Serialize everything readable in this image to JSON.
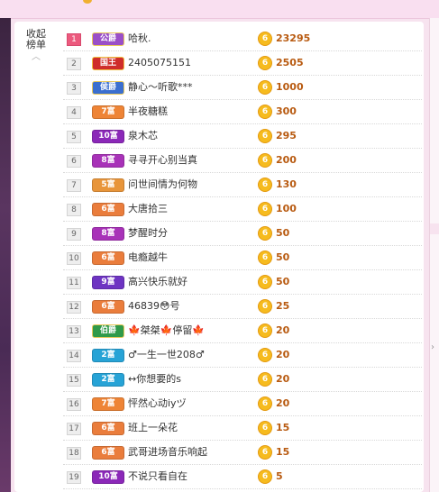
{
  "collapse_label_line1": "收起",
  "collapse_label_line2": "榜单",
  "collapse_arrow": "︿",
  "coin_glyph": "6",
  "rows": [
    {
      "rank": "1",
      "badge": "公爵",
      "badge_type": "gong",
      "name": "哈秋.",
      "amount": "23295"
    },
    {
      "rank": "2",
      "badge": "国王",
      "badge_type": "king",
      "name": "2405075151",
      "amount": "2505"
    },
    {
      "rank": "3",
      "badge": "侯爵",
      "badge_type": "hou",
      "name": "静心～听歌***",
      "amount": "1000"
    },
    {
      "rank": "4",
      "badge": "7富",
      "badge_type": "wealth7",
      "name": "半夜糖糕",
      "amount": "300"
    },
    {
      "rank": "5",
      "badge": "10富",
      "badge_type": "wealth10",
      "name": "泉木芯",
      "amount": "295"
    },
    {
      "rank": "6",
      "badge": "8富",
      "badge_type": "wealth8",
      "name": "寻寻开心别当真",
      "amount": "200"
    },
    {
      "rank": "7",
      "badge": "5富",
      "badge_type": "wealth5",
      "name": "问世间情为何物",
      "amount": "130"
    },
    {
      "rank": "8",
      "badge": "6富",
      "badge_type": "wealth6",
      "name": "大唐拾三",
      "amount": "100"
    },
    {
      "rank": "9",
      "badge": "8富",
      "badge_type": "wealth8",
      "name": "梦醒时分",
      "amount": "50"
    },
    {
      "rank": "10",
      "badge": "6富",
      "badge_type": "wealth6",
      "name": "电瘾越牛",
      "amount": "50"
    },
    {
      "rank": "11",
      "badge": "9富",
      "badge_type": "wealth9",
      "name": "高兴快乐就好",
      "amount": "50"
    },
    {
      "rank": "12",
      "badge": "6富",
      "badge_type": "wealth6",
      "name": "46839😳号",
      "amount": "25"
    },
    {
      "rank": "13",
      "badge": "伯爵",
      "badge_type": "bo",
      "name": "🍁桀桀🍁停留🍁",
      "amount": "20"
    },
    {
      "rank": "14",
      "badge": "2富",
      "badge_type": "wealth2",
      "name": "♂一生一世208♂",
      "amount": "20"
    },
    {
      "rank": "15",
      "badge": "2富",
      "badge_type": "wealth2",
      "name": "↔你想要的s",
      "amount": "20"
    },
    {
      "rank": "16",
      "badge": "7富",
      "badge_type": "wealth7",
      "name": "怦然心动iyヅ",
      "amount": "20"
    },
    {
      "rank": "17",
      "badge": "6富",
      "badge_type": "wealth6",
      "name": "班上一朵花",
      "amount": "15"
    },
    {
      "rank": "18",
      "badge": "6富",
      "badge_type": "wealth6",
      "name": "武哥进场音乐响起",
      "amount": "15"
    },
    {
      "rank": "19",
      "badge": "10富",
      "badge_type": "wealth10",
      "name": "不说只看自在",
      "amount": "5"
    }
  ]
}
